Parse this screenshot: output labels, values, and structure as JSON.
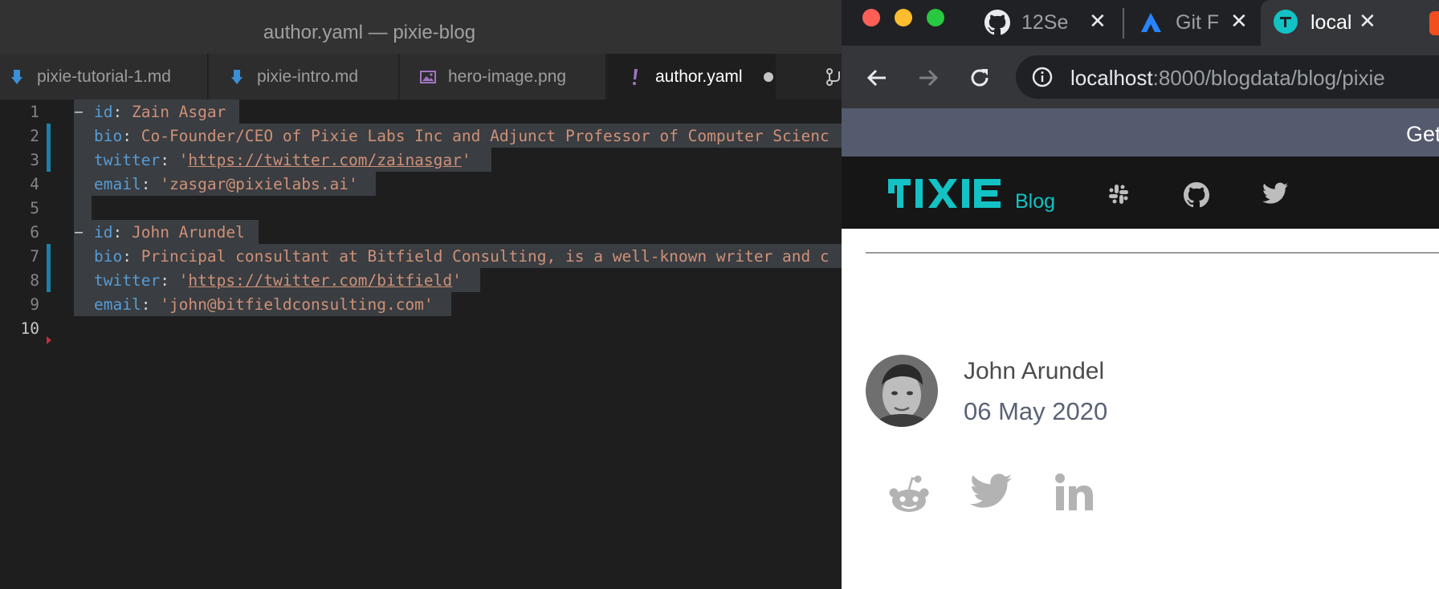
{
  "editor": {
    "window_title": "author.yaml — pixie-blog",
    "tabs": [
      {
        "label": "pixie-tutorial-1.md",
        "icon": "markdown-icon"
      },
      {
        "label": "pixie-intro.md",
        "icon": "markdown-icon"
      },
      {
        "label": "hero-image.png",
        "icon": "image-icon"
      },
      {
        "label": "author.yaml",
        "icon": "yaml-icon",
        "active": true,
        "unsaved": true
      }
    ],
    "line_numbers": [
      "1",
      "2",
      "3",
      "4",
      "5",
      "6",
      "7",
      "8",
      "9",
      "10"
    ],
    "yaml_keys": {
      "id": "id",
      "bio": "bio",
      "twitter": "twitter",
      "email": "email"
    },
    "authors": [
      {
        "id": "Zain Asgar",
        "bio": "Co-Founder/CEO of Pixie Labs Inc and Adjunct Professor of Computer Scienc",
        "twitter": "https://twitter.com/zainasgar",
        "email": "zasgar@pixielabs.ai"
      },
      {
        "id": "John Arundel",
        "bio": "Principal consultant at Bitfield Consulting, is a well-known writer and c",
        "twitter": "https://twitter.com/bitfield",
        "email": "john@bitfieldconsulting.com"
      }
    ],
    "colors": {
      "keyword": "#569cd6",
      "string": "#ce9178",
      "git_modified": "#1b81a8"
    }
  },
  "browser": {
    "tabs": [
      {
        "label": "12Se",
        "icon": "github-icon"
      },
      {
        "label": "Git F",
        "icon": "atlassian-icon"
      },
      {
        "label": "local",
        "icon": "pixie-favicon",
        "active": true
      }
    ],
    "url_host": "localhost",
    "url_rest": ":8000/blogdata/blog/pixie",
    "announcement": "Get",
    "site": {
      "logo_text": "PIXIE",
      "blog_link": "Blog",
      "brand_color": "#12c2c4",
      "nav_icons": [
        "slack-icon",
        "github-icon",
        "twitter-icon"
      ]
    },
    "post": {
      "author_name": "John Arundel",
      "date": "06 May 2020",
      "share_icons": [
        "reddit-icon",
        "twitter-icon",
        "linkedin-icon"
      ]
    }
  }
}
